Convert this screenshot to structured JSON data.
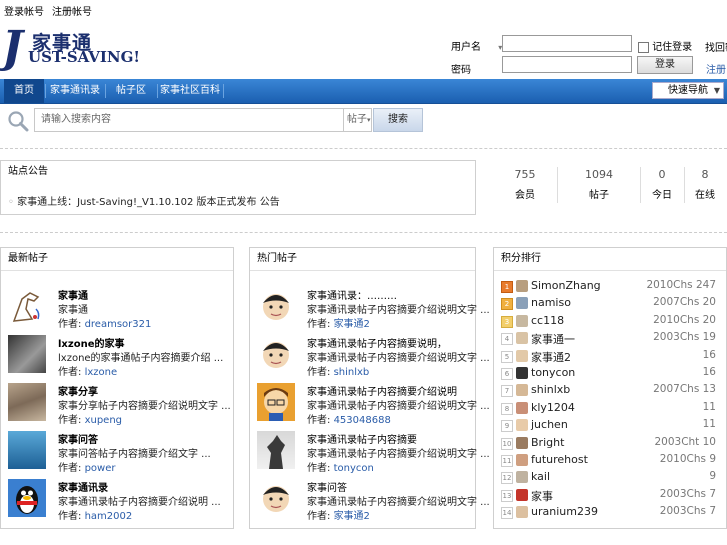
{
  "top_links": [
    "登录帐号",
    "注册帐号"
  ],
  "logo": {
    "cn": "家事通",
    "en": "UST-SAVING!",
    "j": "J"
  },
  "login": {
    "user_label": "用户名",
    "pass_label": "密码",
    "remember_label": "记住登录",
    "submit_label": "登录",
    "register_label": "注册",
    "findpw_label": "找回密码"
  },
  "nav": {
    "items": [
      "首页",
      "家事通讯录",
      "帖子区",
      "家事社区百科"
    ],
    "select_value": "快速导航"
  },
  "search": {
    "placeholder": "请输入搜索内容",
    "type": "帖子",
    "button": "搜索"
  },
  "notice": {
    "title": "站点公告",
    "text": "家事通上线：Just-Saving!_V1.10.102 版本正式发布 公告"
  },
  "stats": [
    {
      "value": "755",
      "label": "会员"
    },
    {
      "value": "1094",
      "label": "帖子"
    },
    {
      "value": "0",
      "label": "今日"
    },
    {
      "value": "8",
      "label": "在线"
    }
  ],
  "left_panel": {
    "title": "最新帖子",
    "items": [
      {
        "title": "家事通",
        "desc": "家事通",
        "author_label": "作者:",
        "author": "dreamsor321",
        "icon": "horse-image"
      },
      {
        "title": "lxzone的家事",
        "desc": "lxzone的家事通帖子内容摘要介绍 ...",
        "author_label": "作者:",
        "author": "lxzone",
        "icon": "portrait-image"
      },
      {
        "title": "家事分享",
        "desc": "家事分享帖子内容摘要介绍说明文字 ...",
        "author_label": "作者:",
        "author": "xupeng",
        "icon": "painting-image"
      },
      {
        "title": "家事问答",
        "desc": "家事问答帖子内容摘要介绍文字 ...",
        "author_label": "作者:",
        "author": "power",
        "icon": "water-image"
      },
      {
        "title": "家事通讯录",
        "desc": "家事通讯录帖子内容摘要介绍说明 ...",
        "author_label": "作者:",
        "author": "ham2002",
        "icon": "penguin-image"
      }
    ]
  },
  "middle_panel": {
    "title": "热门帖子",
    "items": [
      {
        "title": "家事通讯录：………",
        "desc": "家事通讯录帖子内容摘要介绍说明文字 ...",
        "author_label": "作者:",
        "author": "家事通2",
        "icon": "face-avatar"
      },
      {
        "title": "家事通讯录帖子内容摘要说明，",
        "desc": "家事通讯录帖子内容摘要介绍说明文字 ...",
        "author_label": "作者:",
        "author": "shinlxb",
        "icon": "face-avatar"
      },
      {
        "title": "家事通讯录帖子内容摘要介绍说明",
        "desc": "家事通讯录帖子内容摘要介绍说明文字 ...",
        "author_label": "作者:",
        "author": "453048688",
        "icon": "cartoon-avatar"
      },
      {
        "title": "家事通讯录帖子内容摘要",
        "desc": "家事通讯录帖子内容摘要介绍说明文字 ...",
        "author_label": "作者:",
        "author": "tonycon",
        "icon": "statue-image"
      },
      {
        "title": "家事问答",
        "desc": "家事通讯录帖子内容摘要介绍说明文字 ...",
        "author_label": "作者:",
        "author": "家事通2",
        "icon": "face-avatar"
      }
    ]
  },
  "ranking": {
    "title": "积分排行",
    "items": [
      {
        "rank": "1",
        "name": "SimonZhang",
        "score": "2010Chs 247"
      },
      {
        "rank": "2",
        "name": "namiso",
        "score": "2007Chs 20"
      },
      {
        "rank": "3",
        "name": "cc118",
        "score": "2010Chs 20"
      },
      {
        "rank": "4",
        "name": "家事通一",
        "score": "2003Chs 19"
      },
      {
        "rank": "5",
        "name": "家事通2",
        "score": "16"
      },
      {
        "rank": "6",
        "name": "tonycon",
        "score": "16"
      },
      {
        "rank": "7",
        "name": "shinlxb",
        "score": "2007Chs 13"
      },
      {
        "rank": "8",
        "name": "kly1204",
        "score": "11"
      },
      {
        "rank": "9",
        "name": "juchen",
        "score": "11"
      },
      {
        "rank": "10",
        "name": "Bright",
        "score": "2003Cht 10"
      },
      {
        "rank": "11",
        "name": "futurehost",
        "score": "2010Chs 9"
      },
      {
        "rank": "12",
        "name": "kail",
        "score": "9"
      },
      {
        "rank": "13",
        "name": "家事",
        "score": "2003Chs 7"
      },
      {
        "rank": "14",
        "name": "uranium239",
        "score": "2003Chs 7"
      }
    ]
  },
  "colors": {
    "nav_blue": "#1b5fb0",
    "nav_active": "#10478d",
    "link": "#2a5ca8"
  }
}
